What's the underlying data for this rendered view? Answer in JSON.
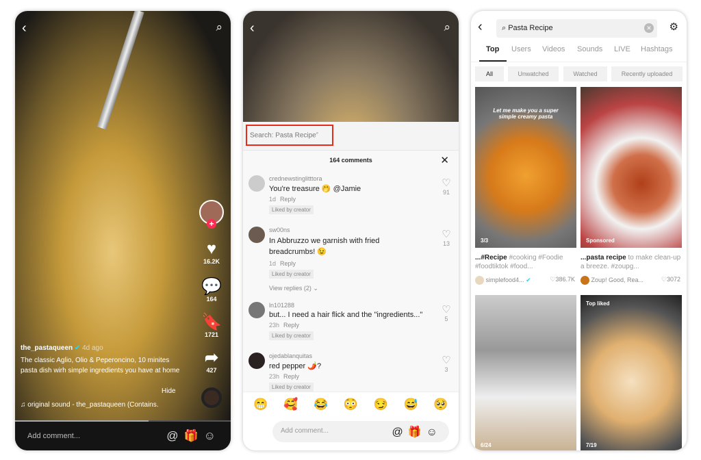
{
  "video": {
    "username": "the_pastaqueen",
    "time_ago": "4d ago",
    "description": "The classic Aglio, Olio & Peperoncino, 10 minites pasta dish wirh simple ingredients you have at home",
    "hide_label": "Hide",
    "sound": "original sound - the_pastaqueen (Contains.",
    "likes": "16.2K",
    "comments": "164",
    "saves": "1721",
    "shares": "427",
    "comment_placeholder": "Add comment..."
  },
  "comments_panel": {
    "search_label": "Search: Pasta Recipe",
    "count_label": "164 comments",
    "comment_placeholder": "Add comment...",
    "comments": [
      {
        "user": "crednewstinglitttora",
        "text": "You're treasure 🤭 @Jamie",
        "time": "1d",
        "reply": "Reply",
        "liked": "Liked by creator",
        "likes": "91"
      },
      {
        "user": "sw00ns",
        "text": "In Abbruzzo we garnish with fried breadcrumbs! 😉",
        "time": "1d",
        "reply": "Reply",
        "liked": "Liked by creator",
        "likes": "13",
        "view_replies": "View replies (2)"
      },
      {
        "user": "ln101288",
        "text": "but... I need a hair flick and the \"ingredients...\"",
        "time": "23h",
        "reply": "Reply",
        "liked": "Liked by creator",
        "likes": "5"
      },
      {
        "user": "ojedablanquitas",
        "text": "red pepper 🌶️?",
        "time": "23h",
        "reply": "Reply",
        "liked": "Liked by creator",
        "likes": "3"
      }
    ],
    "emojis": [
      "😁",
      "🥰",
      "😂",
      "😳",
      "😏",
      "😅",
      "🥺"
    ]
  },
  "search": {
    "query": "Pasta Recipe",
    "tabs": [
      "Top",
      "Users",
      "Videos",
      "Sounds",
      "LIVE",
      "Hashtags"
    ],
    "active_tab": "Top",
    "filters": [
      "All",
      "Unwatched",
      "Watched",
      "Recently uploaded"
    ],
    "results": [
      {
        "badge": "3/3",
        "overlay": "Let me make you a super simple creamy pasta",
        "caption_bold": "...#Recipe",
        "caption": " #cooking #Foodie #foodtiktok #food...",
        "author": "simplefood4...",
        "likes": "386.7K"
      },
      {
        "badge": "Sponsored",
        "caption_bold": "...pasta recipe",
        "caption": " to make clean-up a breeze. #zoupg...",
        "author": "Zoup! Good, Rea...",
        "likes": "3072"
      },
      {
        "badge": "6/24"
      },
      {
        "top_badge": "Top liked",
        "badge": "7/19"
      }
    ]
  },
  "colors": {
    "accent_red": "#fe2c55",
    "highlight_box": "#e8291c",
    "verified": "#20d5ec"
  }
}
